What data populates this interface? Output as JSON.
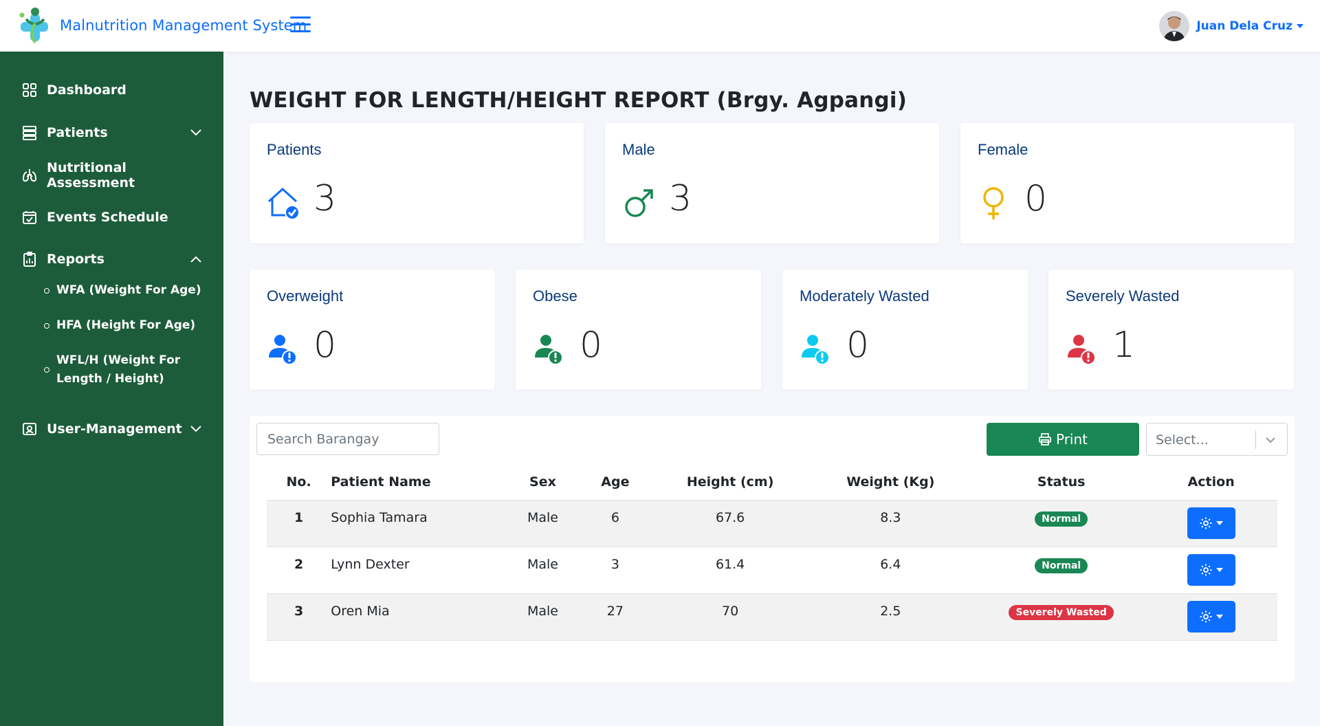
{
  "app": {
    "title": "Malnutrition Management System"
  },
  "user": {
    "name": "Juan Dela Cruz"
  },
  "sidebar": {
    "items": [
      {
        "label": "Dashboard"
      },
      {
        "label": "Patients"
      },
      {
        "label": "Nutritional Assessment"
      },
      {
        "label": "Events Schedule"
      },
      {
        "label": "Reports"
      },
      {
        "label": "User-Management"
      }
    ],
    "report_subitems": [
      {
        "label": "WFA (Weight For Age)"
      },
      {
        "label": "HFA (Height For Age)"
      },
      {
        "label": "WFL/H (Weight For Length / Height)"
      }
    ]
  },
  "page": {
    "title": "WEIGHT FOR LENGTH/HEIGHT REPORT (Brgy. Agpangi)"
  },
  "stats_top": [
    {
      "label": "Patients",
      "value": "3",
      "icon": "house-check-icon",
      "color": "#0d6efd"
    },
    {
      "label": "Male",
      "value": "3",
      "icon": "male-symbol-icon",
      "color": "#198754"
    },
    {
      "label": "Female",
      "value": "0",
      "icon": "female-symbol-icon",
      "color": "#f0b400"
    }
  ],
  "stats_bottom": [
    {
      "label": "Overweight",
      "value": "0",
      "icon": "person-exclamation-icon",
      "color": "#0d6efd"
    },
    {
      "label": "Obese",
      "value": "0",
      "icon": "person-exclamation-icon",
      "color": "#198754"
    },
    {
      "label": "Moderately Wasted",
      "value": "0",
      "icon": "person-exclamation-icon",
      "color": "#0dcaf0"
    },
    {
      "label": "Severely Wasted",
      "value": "1",
      "icon": "person-exclamation-icon",
      "color": "#dc3545"
    }
  ],
  "search": {
    "placeholder": "Search Barangay"
  },
  "print": {
    "label": "Print"
  },
  "select": {
    "placeholder": "Select..."
  },
  "table": {
    "headers": [
      "No.",
      "Patient Name",
      "Sex",
      "Age",
      "Height (cm)",
      "Weight (Kg)",
      "Status",
      "Action"
    ],
    "rows": [
      {
        "no": "1",
        "name": "Sophia Tamara",
        "sex": "Male",
        "age": "6",
        "height": "67.6",
        "weight": "8.3",
        "status": "Normal",
        "status_type": "normal"
      },
      {
        "no": "2",
        "name": "Lynn Dexter",
        "sex": "Male",
        "age": "3",
        "height": "61.4",
        "weight": "6.4",
        "status": "Normal",
        "status_type": "normal"
      },
      {
        "no": "3",
        "name": "Oren Mia",
        "sex": "Male",
        "age": "27",
        "height": "70",
        "weight": "2.5",
        "status": "Severely Wasted",
        "status_type": "severe"
      }
    ]
  }
}
